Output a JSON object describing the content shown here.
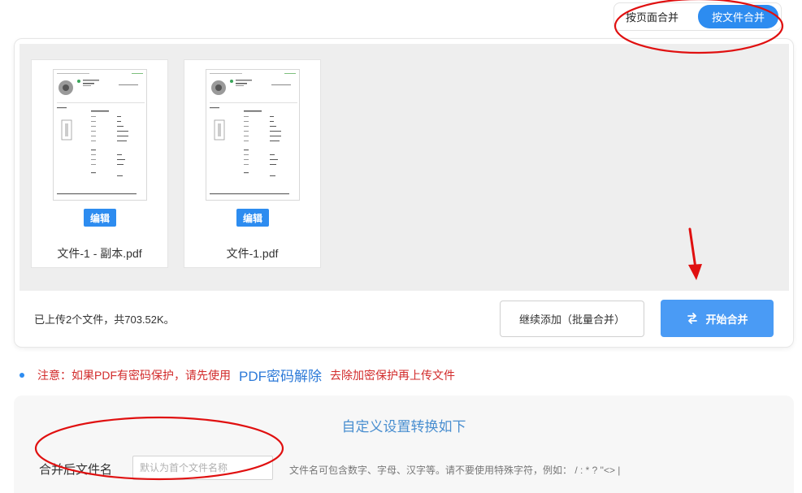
{
  "mode_toggle": {
    "by_page_label": "按页面合并",
    "by_file_label": "按文件合并",
    "active": "by_file"
  },
  "files": [
    {
      "name": "文件-1 - 副本.pdf",
      "edit_label": "编辑"
    },
    {
      "name": "文件-1.pdf",
      "edit_label": "编辑"
    }
  ],
  "upload_status": "已上传2个文件，共703.52K。",
  "actions": {
    "add_more_label": "继续添加（批量合并）",
    "start_label": "开始合并",
    "start_icon": "swap-arrows-icon"
  },
  "notice": {
    "prefix": "注意：如果PDF有密码保护，请先使用",
    "link": "PDF密码解除",
    "suffix": "去除加密保护再上传文件"
  },
  "settings": {
    "title": "自定义设置转换如下",
    "filename_label": "合并后文件名",
    "filename_placeholder": "默认为首个文件名称",
    "filename_value": "",
    "filename_hint": "文件名可包含数字、字母、汉字等。请不要使用特殊字符，例如：  / : * ? \"<> |"
  },
  "colors": {
    "accent": "#2d8cf0",
    "start_button": "#4a9bf5",
    "notice_red": "#d22b2b",
    "annotation_red": "#e01010"
  }
}
